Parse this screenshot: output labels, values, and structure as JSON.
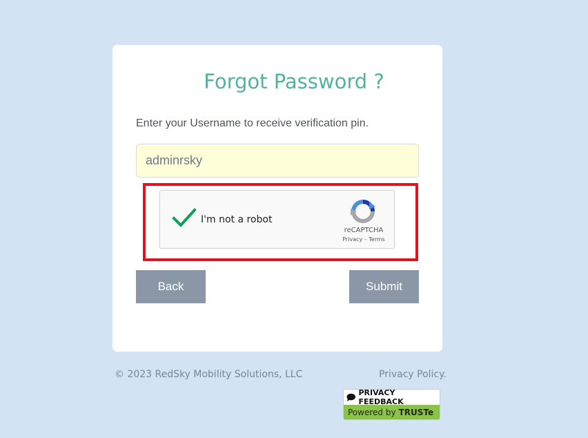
{
  "page": {
    "background_color": "#d3e3f3"
  },
  "form": {
    "title": "Forgot Password ?",
    "instruction": "Enter your Username to receive verification pin.",
    "username_value": "adminrsky",
    "back_label": "Back",
    "submit_label": "Submit",
    "title_color": "#52b2a0",
    "button_color": "#8b96a6",
    "input_background": "#fefed8"
  },
  "recaptcha": {
    "checkbox_label": "I'm not a robot",
    "checked": true,
    "brand": "reCAPTCHA",
    "privacy_link": "Privacy",
    "separator": "-",
    "terms_link": "Terms",
    "checkmark_color": "#0f9d58",
    "highlight_color": "#e3121f"
  },
  "footer": {
    "copyright": "© 2023 RedSky Mobility Solutions, LLC",
    "privacy_policy": "Privacy Policy.",
    "truste_top": "PRIVACY FEEDBACK",
    "truste_powered": "Powered by",
    "truste_brand": "TRUSTe"
  }
}
